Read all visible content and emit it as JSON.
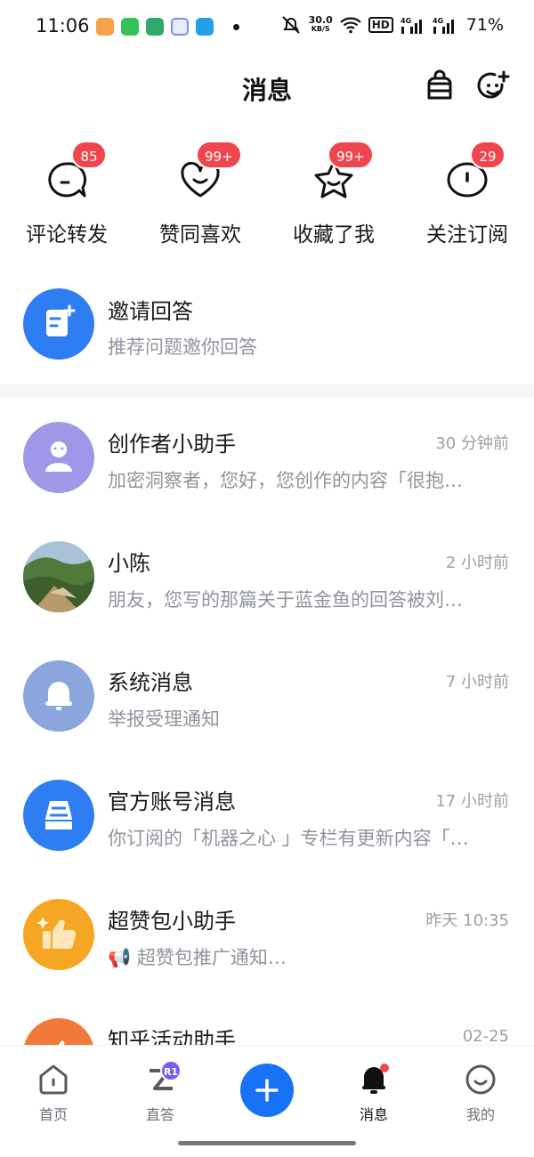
{
  "status_bar": {
    "time": "11:06",
    "net_speed_value": "30.0",
    "net_speed_unit": "KB/S",
    "hd": "HD",
    "signal_1": "4G",
    "signal_2": "4G",
    "battery": "71%"
  },
  "header": {
    "title": "消息"
  },
  "quick_actions": [
    {
      "label": "评论转发",
      "badge": "85",
      "icon": "comment-icon"
    },
    {
      "label": "赞同喜欢",
      "badge": "99+",
      "icon": "heart-smile-icon"
    },
    {
      "label": "收藏了我",
      "badge": "99+",
      "icon": "star-icon"
    },
    {
      "label": "关注订阅",
      "badge": "29",
      "icon": "follow-icon"
    }
  ],
  "invite": {
    "title": "邀请回答",
    "subtitle": "推荐问题邀你回答"
  },
  "messages": [
    {
      "name": "创作者小助手",
      "time": "30 分钟前",
      "preview": "加密洞察者，您好，您创作的内容「很抱…",
      "avatar_color": "#9f98e8"
    },
    {
      "name": "小陈",
      "time": "2 小时前",
      "preview": "朋友，您写的那篇关于蓝金鱼的回答被刘…",
      "avatar_color": "#6f8a5a"
    },
    {
      "name": "系统消息",
      "time": "7 小时前",
      "preview": "举报受理通知",
      "avatar_color": "#8aa6dc"
    },
    {
      "name": "官方账号消息",
      "time": "17 小时前",
      "preview": "你订阅的「机器之心 」专栏有更新内容「…",
      "avatar_color": "#2f7df3"
    },
    {
      "name": "超赞包小助手",
      "time": "昨天 10:35",
      "preview": "📢 超赞包推广通知…",
      "avatar_color": "#f5a623"
    },
    {
      "name": "知乎活动助手",
      "time": "02-25",
      "preview": "",
      "avatar_color": "#f07a3a"
    }
  ],
  "bottom_nav": [
    {
      "label": "首页",
      "icon": "home-icon"
    },
    {
      "label": "直答",
      "icon": "zhida-icon",
      "badge": "R1"
    },
    {
      "label": "",
      "icon": "plus-icon"
    },
    {
      "label": "消息",
      "icon": "bell-icon",
      "active": true
    },
    {
      "label": "我的",
      "icon": "profile-icon"
    }
  ]
}
